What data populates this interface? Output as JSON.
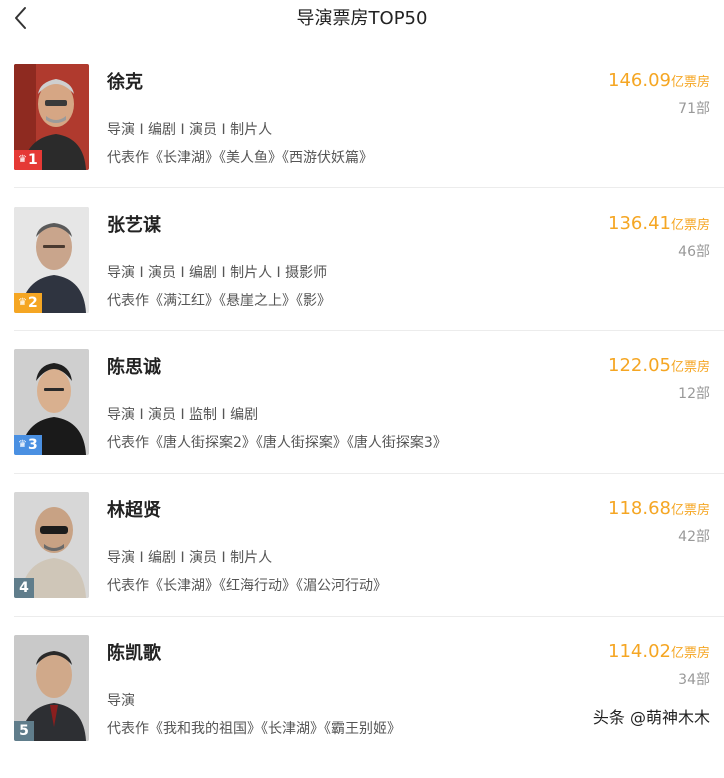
{
  "header": {
    "title": "导演票房TOP50",
    "back_icon": "chevron-left-icon"
  },
  "colors": {
    "accent": "#f5a623",
    "rank1": "#e53935",
    "rank2": "#f5a623",
    "rank3": "#4a90e2",
    "rank_other": "#607d8b"
  },
  "directors": [
    {
      "rank": "1",
      "name": "徐克",
      "roles": "导演 I 编剧 I 演员 I 制片人",
      "works": "代表作《长津湖》《美人鱼》《西游伏妖篇》",
      "box_office": "146.09",
      "unit": "亿票房",
      "films": "71部"
    },
    {
      "rank": "2",
      "name": "张艺谋",
      "roles": "导演 I 演员 I 编剧 I 制片人 I 摄影师",
      "works": "代表作《满江红》《悬崖之上》《影》",
      "box_office": "136.41",
      "unit": "亿票房",
      "films": "46部"
    },
    {
      "rank": "3",
      "name": "陈思诚",
      "roles": "导演 I 演员 I 监制 I 编剧",
      "works": "代表作《唐人街探案2》《唐人街探案》《唐人街探案3》",
      "box_office": "122.05",
      "unit": "亿票房",
      "films": "12部"
    },
    {
      "rank": "4",
      "name": "林超贤",
      "roles": "导演 I 编剧 I 演员 I 制片人",
      "works": "代表作《长津湖》《红海行动》《湄公河行动》",
      "box_office": "118.68",
      "unit": "亿票房",
      "films": "42部"
    },
    {
      "rank": "5",
      "name": "陈凯歌",
      "roles": "导演",
      "works": "代表作《我和我的祖国》《长津湖》《霸王别姬》",
      "box_office": "114.02",
      "unit": "亿票房",
      "films": "34部"
    }
  ],
  "watermark": "头条 @萌神木木"
}
